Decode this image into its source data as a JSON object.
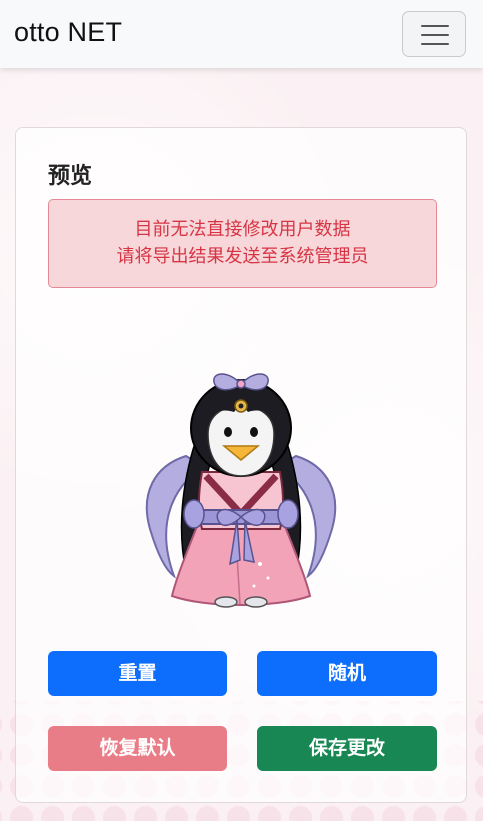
{
  "navbar": {
    "brand": "otto NET",
    "toggler_icon": "hamburger-menu-icon"
  },
  "card": {
    "title": "预览",
    "alert": {
      "line1": "目前无法直接修改用户数据",
      "line2": "请将导出结果发送至系统管理员"
    },
    "avatar": {
      "description_icon": "penguin-avatar"
    },
    "buttons": {
      "reset": "重置",
      "random": "随机",
      "restore_default": "恢复默认",
      "save": "保存更改"
    }
  },
  "colors": {
    "primary": "#0d6efd",
    "danger_light": "#e97d87",
    "success": "#198754",
    "alert_bg": "#f8d7da",
    "alert_text": "#d63545"
  }
}
